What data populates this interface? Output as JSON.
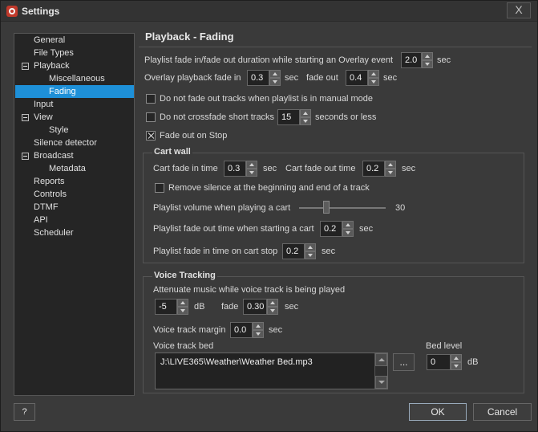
{
  "window": {
    "title": "Settings",
    "close_label": "X"
  },
  "colors": {
    "selection": "#1e90d8",
    "background": "#3a3a3a"
  },
  "tree": {
    "items": [
      {
        "label": "General"
      },
      {
        "label": "File Types"
      },
      {
        "label": "Playback"
      },
      {
        "label": "Miscellaneous"
      },
      {
        "label": "Fading"
      },
      {
        "label": "Input"
      },
      {
        "label": "View"
      },
      {
        "label": "Style"
      },
      {
        "label": "Silence detector"
      },
      {
        "label": "Broadcast"
      },
      {
        "label": "Metadata"
      },
      {
        "label": "Reports"
      },
      {
        "label": "Controls"
      },
      {
        "label": "DTMF"
      },
      {
        "label": "API"
      },
      {
        "label": "Scheduler"
      }
    ],
    "selected": "Fading"
  },
  "panel": {
    "title": "Playback - Fading",
    "overlay_event_label": "Playlist fade in/fade out duration while starting an Overlay event",
    "overlay_event_value": "2.0",
    "overlay_fadein_label": "Overlay playback fade in",
    "overlay_fadein_value": "0.3",
    "fadeout_label": "fade out",
    "fadeout_value": "0.4",
    "sec": "sec",
    "no_fade_manual_label": "Do not fade out tracks when playlist is in manual mode",
    "no_fade_manual_checked": false,
    "no_crossfade_label": "Do not crossfade short tracks",
    "no_crossfade_value": "15",
    "no_crossfade_suffix": "seconds or less",
    "no_crossfade_checked": false,
    "fade_on_stop_label": "Fade out on Stop",
    "fade_on_stop_checked": true
  },
  "cart_wall": {
    "title": "Cart wall",
    "fade_in_label": "Cart fade in time",
    "fade_in_value": "0.3",
    "fade_out_label": "Cart fade out time",
    "fade_out_value": "0.2",
    "remove_silence_label": "Remove silence at the beginning and end of a track",
    "remove_silence_checked": false,
    "volume_label": "Playlist volume when playing a cart",
    "volume_value": "30",
    "volume_level": 0.3,
    "fade_out_start_label": "Playlist fade out time when starting a cart",
    "fade_out_start_value": "0.2",
    "fade_in_stop_label": "Playlist fade in time on cart stop",
    "fade_in_stop_value": "0.2"
  },
  "voice_tracking": {
    "title": "Voice Tracking",
    "attenuate_label": "Attenuate music while voice track is being played",
    "attenuate_value": "-5",
    "db": "dB",
    "fade_label": "fade",
    "fade_value": "0.30",
    "margin_label": "Voice track margin",
    "margin_value": "0.0",
    "bed_label": "Voice track bed",
    "bed_path": "J:\\LIVE365\\Weather\\Weather Bed.mp3",
    "browse_label": "...",
    "bed_level_label": "Bed level",
    "bed_level_value": "0"
  },
  "footer": {
    "help_label": "?",
    "ok_label": "OK",
    "cancel_label": "Cancel"
  }
}
